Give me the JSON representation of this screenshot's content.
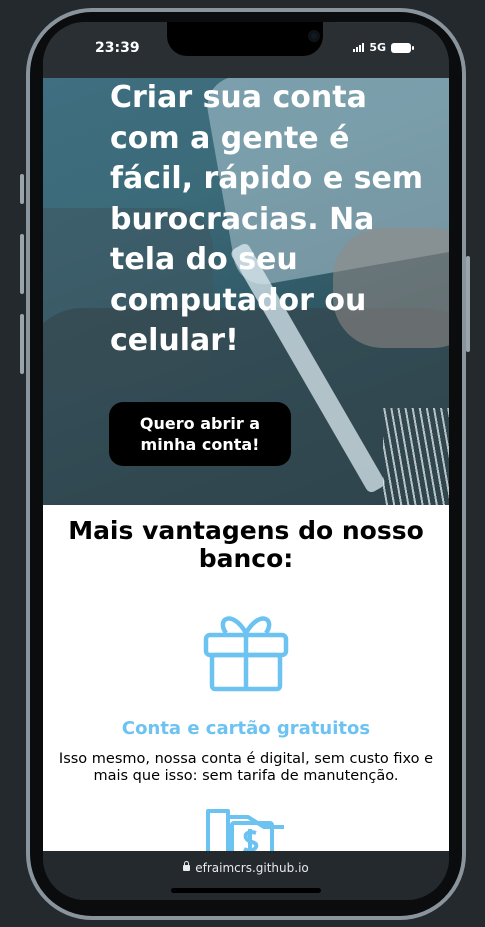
{
  "status_bar": {
    "time": "23:39",
    "network": "5G"
  },
  "hero": {
    "title": "Criar sua conta com a gente é fácil, rápido e sem burocracias. Na tela do seu computador ou celular!",
    "cta_label": "Quero abrir a\nminha conta!"
  },
  "benefits": {
    "title": "Mais vantagens do nosso banco:",
    "features": [
      {
        "icon": "gift-icon",
        "title": "Conta e cartão gratuitos",
        "text": "Isso mesmo, nossa conta é digital, sem custo fixo e mais que isso: sem tarifa de manutenção."
      },
      {
        "icon": "money-hand-icon"
      }
    ]
  },
  "browser": {
    "url": "efraimcrs.github.io"
  },
  "colors": {
    "accent": "#6cc3f2",
    "cta_background": "#000000",
    "frame": "#23292d"
  }
}
